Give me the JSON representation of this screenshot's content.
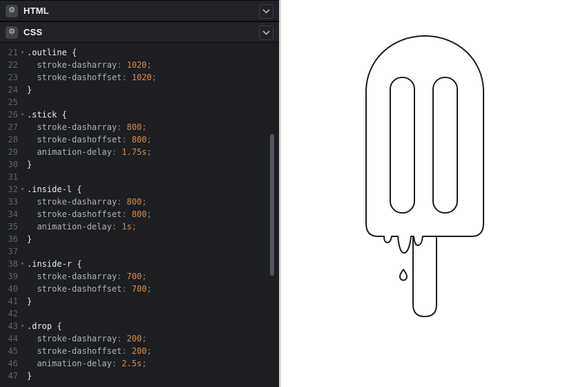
{
  "panels": {
    "html": {
      "title": "HTML",
      "gear_glyph": "⚙"
    },
    "css": {
      "title": "CSS",
      "gear_glyph": "⚙"
    }
  },
  "colors": {
    "editor_background": "#1d1e22",
    "header_background": "#212227",
    "value_orange": "#de8c45",
    "property_gray": "#a9b3bd",
    "selector_white": "#e6e9ed",
    "line_number_gray": "#5f646b",
    "preview_background": "#ffffff",
    "drawing_stroke": "#1c1c1c"
  },
  "editor": {
    "language": "CSS",
    "first_visible_line": 21,
    "last_visible_line": 47,
    "lines": [
      {
        "num": "21",
        "fold": true,
        "segs": [
          [
            "sel",
            ".outline"
          ],
          [
            "pln",
            " {"
          ]
        ]
      },
      {
        "num": "22",
        "segs": [
          [
            "prop",
            "  stroke-dasharray"
          ],
          [
            "punc",
            ":"
          ],
          [
            "val",
            " 1020"
          ],
          [
            "punc",
            ";"
          ]
        ]
      },
      {
        "num": "23",
        "segs": [
          [
            "prop",
            "  stroke-dashoffset"
          ],
          [
            "punc",
            ":"
          ],
          [
            "val",
            " 1020"
          ],
          [
            "punc",
            ";"
          ]
        ]
      },
      {
        "num": "24",
        "segs": [
          [
            "pln",
            "}"
          ]
        ]
      },
      {
        "num": "25",
        "segs": []
      },
      {
        "num": "26",
        "fold": true,
        "segs": [
          [
            "sel",
            ".stick"
          ],
          [
            "pln",
            " {"
          ]
        ]
      },
      {
        "num": "27",
        "segs": [
          [
            "prop",
            "  stroke-dasharray"
          ],
          [
            "punc",
            ":"
          ],
          [
            "val",
            " 800"
          ],
          [
            "punc",
            ";"
          ]
        ]
      },
      {
        "num": "28",
        "segs": [
          [
            "prop",
            "  stroke-dashoffset"
          ],
          [
            "punc",
            ":"
          ],
          [
            "val",
            " 800"
          ],
          [
            "punc",
            ";"
          ]
        ]
      },
      {
        "num": "29",
        "segs": [
          [
            "prop",
            "  animation-delay"
          ],
          [
            "punc",
            ":"
          ],
          [
            "val",
            " 1.75s"
          ],
          [
            "punc",
            ";"
          ]
        ]
      },
      {
        "num": "30",
        "segs": [
          [
            "pln",
            "}"
          ]
        ]
      },
      {
        "num": "31",
        "segs": []
      },
      {
        "num": "32",
        "fold": true,
        "segs": [
          [
            "sel",
            ".inside-l"
          ],
          [
            "pln",
            " {"
          ]
        ]
      },
      {
        "num": "33",
        "segs": [
          [
            "prop",
            "  stroke-dasharray"
          ],
          [
            "punc",
            ":"
          ],
          [
            "val",
            " 800"
          ],
          [
            "punc",
            ";"
          ]
        ]
      },
      {
        "num": "34",
        "segs": [
          [
            "prop",
            "  stroke-dashoffset"
          ],
          [
            "punc",
            ":"
          ],
          [
            "val",
            " 800"
          ],
          [
            "punc",
            ";"
          ]
        ]
      },
      {
        "num": "35",
        "segs": [
          [
            "prop",
            "  animation-delay"
          ],
          [
            "punc",
            ":"
          ],
          [
            "val",
            " 1s"
          ],
          [
            "punc",
            ";"
          ]
        ]
      },
      {
        "num": "36",
        "segs": [
          [
            "pln",
            "}"
          ]
        ]
      },
      {
        "num": "37",
        "segs": []
      },
      {
        "num": "38",
        "fold": true,
        "segs": [
          [
            "sel",
            ".inside-r"
          ],
          [
            "pln",
            " {"
          ]
        ]
      },
      {
        "num": "39",
        "segs": [
          [
            "prop",
            "  stroke-dasharray"
          ],
          [
            "punc",
            ":"
          ],
          [
            "val",
            " 700"
          ],
          [
            "punc",
            ";"
          ]
        ]
      },
      {
        "num": "40",
        "segs": [
          [
            "prop",
            "  stroke-dashoffset"
          ],
          [
            "punc",
            ":"
          ],
          [
            "val",
            " 700"
          ],
          [
            "punc",
            ";"
          ]
        ]
      },
      {
        "num": "41",
        "segs": [
          [
            "pln",
            "}"
          ]
        ]
      },
      {
        "num": "42",
        "segs": []
      },
      {
        "num": "43",
        "fold": true,
        "segs": [
          [
            "sel",
            ".drop"
          ],
          [
            "pln",
            " {"
          ]
        ]
      },
      {
        "num": "44",
        "segs": [
          [
            "prop",
            "  stroke-dasharray"
          ],
          [
            "punc",
            ":"
          ],
          [
            "val",
            " 200"
          ],
          [
            "punc",
            ";"
          ]
        ]
      },
      {
        "num": "45",
        "segs": [
          [
            "prop",
            "  stroke-dashoffset"
          ],
          [
            "punc",
            ":"
          ],
          [
            "val",
            " 200"
          ],
          [
            "punc",
            ";"
          ]
        ]
      },
      {
        "num": "46",
        "segs": [
          [
            "prop",
            "  animation-delay"
          ],
          [
            "punc",
            ":"
          ],
          [
            "val",
            " 2.5s"
          ],
          [
            "punc",
            ";"
          ]
        ]
      },
      {
        "num": "47",
        "segs": [
          [
            "pln",
            "}"
          ]
        ]
      }
    ]
  },
  "preview": {
    "drawing": "popsicle-line-art"
  }
}
